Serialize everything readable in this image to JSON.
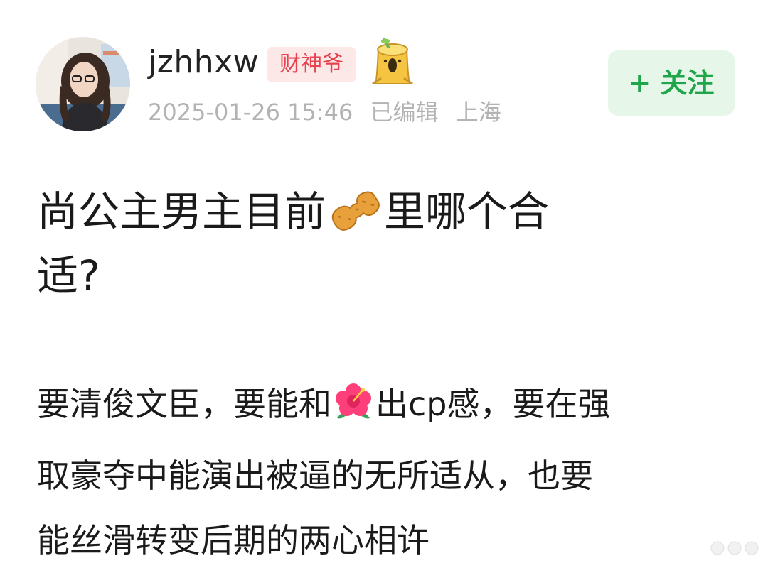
{
  "post": {
    "username": "jzhhxw",
    "badge": "财神爷",
    "timestamp": "2025-01-26 15:46",
    "edited": "已编辑",
    "location": "上海",
    "follow_label": "+ 关注"
  },
  "title": {
    "line1_before": "尚公主男主目前",
    "line1_emoji": "peanut-emoji",
    "line1_after": "里哪个合",
    "line2": "适?"
  },
  "body": {
    "line1_before": "要清俊文臣，要能和",
    "line1_emoji": "hibiscus-emoji",
    "line1_after": "出cp感，要在强",
    "line2": "取豪夺中能演出被逼的无所适从，也要",
    "line3": "能丝滑转变后期的两心相许"
  },
  "icons": {
    "avatar": "avatar-photo",
    "badge_icon": "tree-stump-icon",
    "watermark": "more-dots-icon"
  },
  "colors": {
    "badge_bg": "#fde8e8",
    "badge_text": "#e6424f",
    "follow_bg": "#e6f7e9",
    "follow_text": "#1fa64a",
    "meta_text": "#b3b3b3",
    "main_text": "#1a1a1a"
  }
}
